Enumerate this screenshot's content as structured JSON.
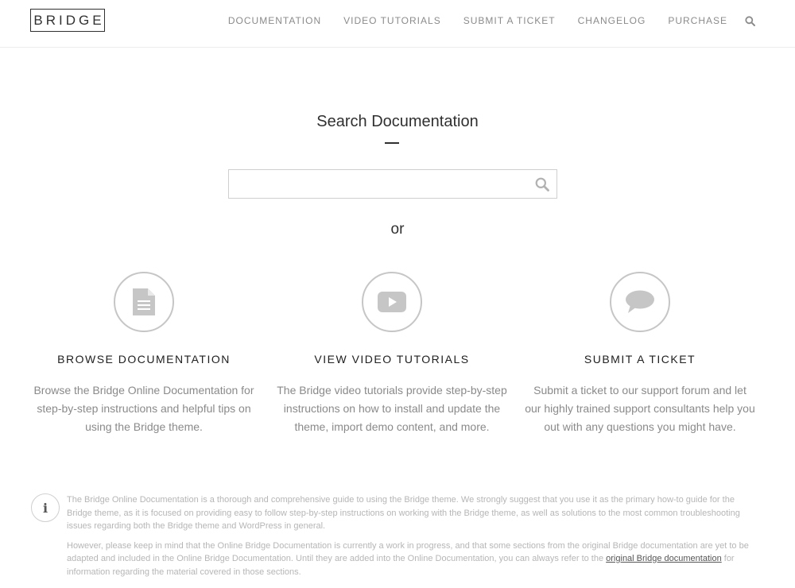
{
  "header": {
    "logo": "BRIDGE",
    "nav": [
      "DOCUMENTATION",
      "VIDEO TUTORIALS",
      "SUBMIT A TICKET",
      "CHANGELOG",
      "PURCHASE"
    ],
    "search_icon": "search-icon"
  },
  "search": {
    "title": "Search Documentation",
    "value": "",
    "placeholder": "",
    "or_text": "or"
  },
  "features": [
    {
      "icon": "document-icon",
      "title": "BROWSE DOCUMENTATION",
      "text": "Browse the Bridge Online Documentation for step-by-step instructions and helpful tips on using the Bridge theme."
    },
    {
      "icon": "video-play-icon",
      "title": "VIEW VIDEO TUTORIALS",
      "text": "The Bridge video tutorials provide step-by-step instructions on how to install and update the theme, import demo content, and more."
    },
    {
      "icon": "speech-bubble-icon",
      "title": "SUBMIT A TICKET",
      "text": "Submit a ticket to our support forum and let our highly trained support consultants help you out with any questions you might have."
    }
  ],
  "info": {
    "icon": "info-icon",
    "glyph": "i",
    "paragraph1": "The Bridge Online Documentation is a thorough and comprehensive guide to using the Bridge theme. We strongly suggest that you use it as the primary how-to guide for the Bridge theme, as it is focused on providing easy to follow step-by-step instructions on working with the Bridge theme, as well as solutions to the most common troubleshooting issues regarding both the Bridge theme and WordPress in general.",
    "paragraph2_before": "However, please keep in mind that the Online Bridge Documentation is currently a work in progress, and that some sections from the original Bridge documentation are yet to be adapted and included in the Online Bridge Documentation. Until they are added into the Online Documentation, you can always refer to the ",
    "paragraph2_link": "original Bridge documentation",
    "paragraph2_after": " for information regarding the material covered in those sections."
  },
  "colors": {
    "text_dark": "#303030",
    "text_muted": "#8a8a8a",
    "icon_gray": "#c6c6c6"
  }
}
